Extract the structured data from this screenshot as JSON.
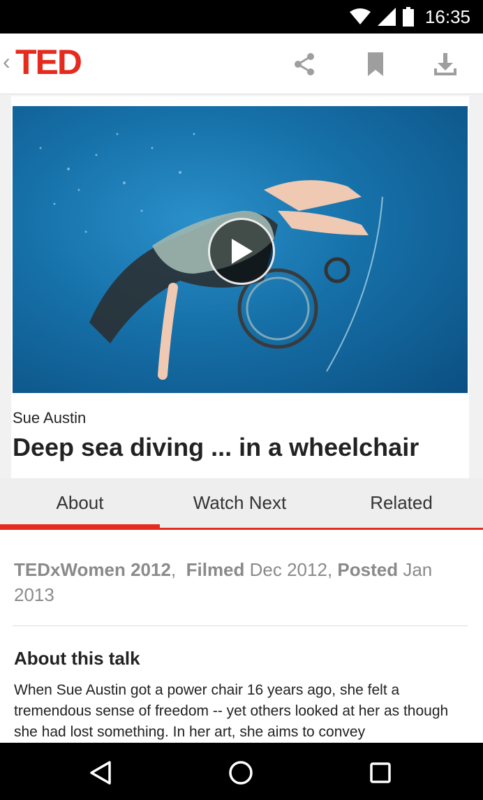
{
  "status_bar": {
    "time": "16:35",
    "icons": [
      "wifi-icon",
      "signal-icon",
      "battery-icon"
    ]
  },
  "app_bar": {
    "logo": "TED",
    "actions": [
      "share-icon",
      "bookmark-icon",
      "download-icon"
    ]
  },
  "colors": {
    "brand": "#e62b1e",
    "tabs_bg": "#eeeeee",
    "status_bar": "#000000"
  },
  "talk": {
    "speaker": "Sue Austin",
    "title": "Deep sea diving ... in a wheelchair"
  },
  "tabs": [
    {
      "label": "About",
      "selected": true
    },
    {
      "label": "Watch Next",
      "selected": false
    },
    {
      "label": "Related",
      "selected": false
    }
  ],
  "meta": {
    "event": "TEDxWomen 2012",
    "filmed_label": "Filmed",
    "filmed_value": "Dec 2012",
    "posted_label": "Posted",
    "posted_value": "Jan 2013"
  },
  "about": {
    "heading": "About this talk",
    "body": "When Sue Austin got a power chair 16 years ago, she felt a tremendous sense of freedom -- yet others looked at her as though she had lost something. In her art, she aims to convey"
  },
  "nav_bar": {
    "buttons": [
      "back-icon",
      "home-icon",
      "recents-icon"
    ]
  }
}
